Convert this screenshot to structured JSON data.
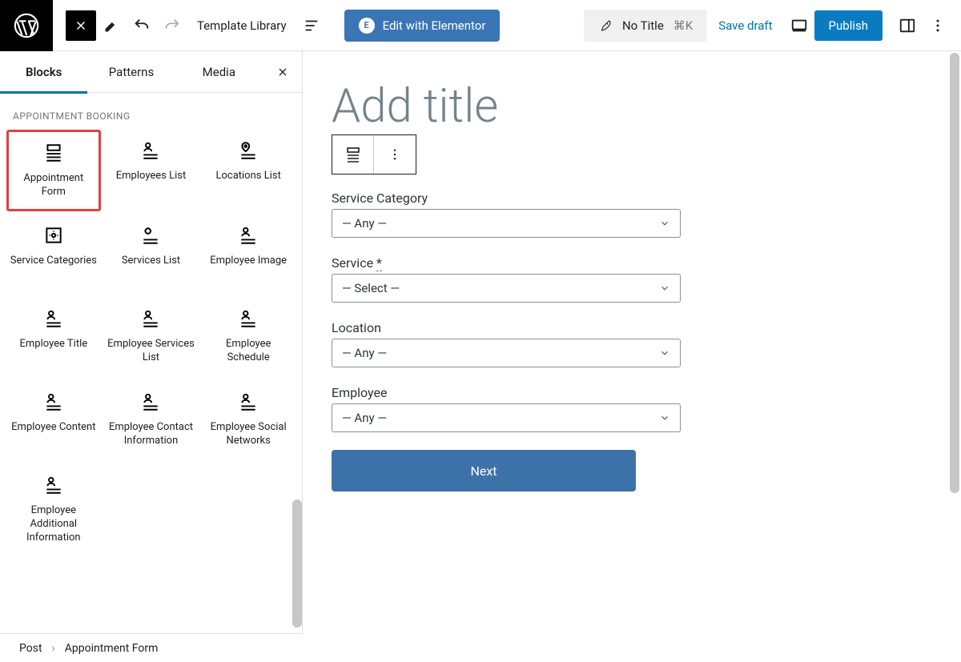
{
  "topbar": {
    "template_lib": "Template Library",
    "elementor": "Edit with Elementor",
    "notitle": "No Title",
    "shortcut": "⌘K",
    "save_draft": "Save draft",
    "publish": "Publish"
  },
  "tabs": {
    "blocks": "Blocks",
    "patterns": "Patterns",
    "media": "Media"
  },
  "sidebar": {
    "section": "APPOINTMENT BOOKING",
    "items": [
      {
        "label": "Appointment Form",
        "icon": "form"
      },
      {
        "label": "Employees List",
        "icon": "person-list"
      },
      {
        "label": "Locations List",
        "icon": "pin-list"
      },
      {
        "label": "Service Categories",
        "icon": "gear-box"
      },
      {
        "label": "Services List",
        "icon": "gear-list"
      },
      {
        "label": "Employee Image",
        "icon": "person-list"
      },
      {
        "label": "Employee Title",
        "icon": "person-list"
      },
      {
        "label": "Employee Services List",
        "icon": "person-list"
      },
      {
        "label": "Employee Schedule",
        "icon": "person-list"
      },
      {
        "label": "Employee Content",
        "icon": "person-list"
      },
      {
        "label": "Employee Contact Information",
        "icon": "person-list"
      },
      {
        "label": "Employee Social Networks",
        "icon": "person-list"
      },
      {
        "label": "Employee Additional Information",
        "icon": "person-list"
      }
    ]
  },
  "editor": {
    "title_placeholder": "Add title",
    "fields": [
      {
        "label": "Service Category",
        "value": "— Any —",
        "required": false
      },
      {
        "label": "Service",
        "value": "— Select —",
        "required": true
      },
      {
        "label": "Location",
        "value": "— Any —",
        "required": false
      },
      {
        "label": "Employee",
        "value": "— Any —",
        "required": false
      }
    ],
    "next": "Next",
    "req_marker": "*"
  },
  "breadcrumb": {
    "root": "Post",
    "current": "Appointment Form"
  }
}
